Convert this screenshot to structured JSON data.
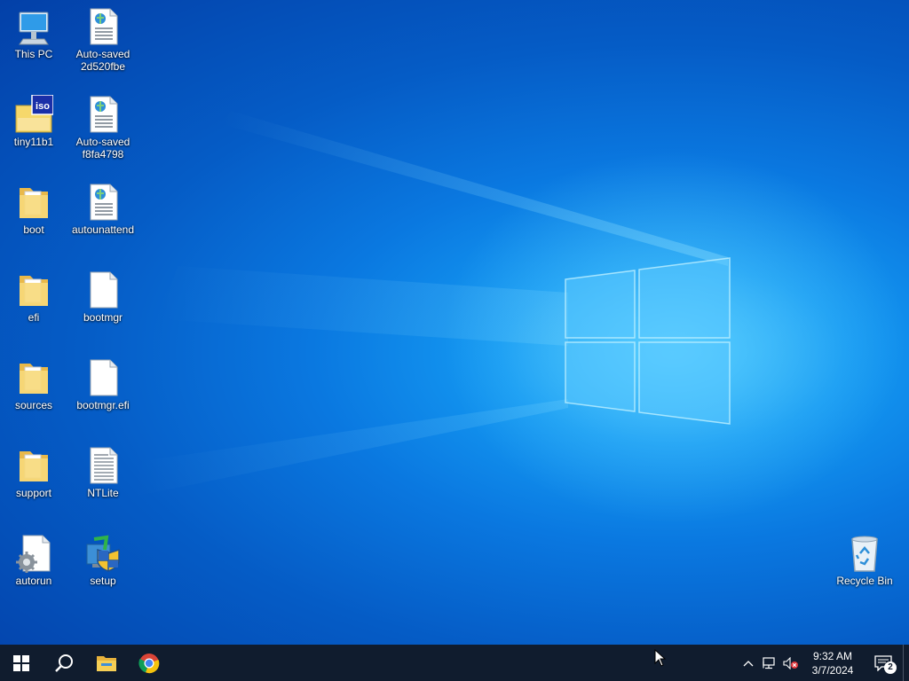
{
  "desktop": {
    "icons": [
      {
        "label": "This PC",
        "icon": "computer-icon"
      },
      {
        "label": "Auto-saved\n2d520fbe",
        "icon": "html-document-icon"
      },
      {
        "label": "tiny11b1",
        "icon": "iso-file-icon"
      },
      {
        "label": "Auto-saved\nf8fa4798",
        "icon": "html-document-icon"
      },
      {
        "label": "boot",
        "icon": "folder-icon"
      },
      {
        "label": "autounattend",
        "icon": "html-document-icon"
      },
      {
        "label": "efi",
        "icon": "folder-icon"
      },
      {
        "label": "bootmgr",
        "icon": "file-icon"
      },
      {
        "label": "sources",
        "icon": "folder-icon"
      },
      {
        "label": "bootmgr.efi",
        "icon": "file-icon"
      },
      {
        "label": "support",
        "icon": "folder-icon"
      },
      {
        "label": "NTLite",
        "icon": "text-document-icon"
      },
      {
        "label": "autorun",
        "icon": "settings-file-icon"
      },
      {
        "label": "setup",
        "icon": "setup-shield-icon"
      },
      {
        "label": "Recycle Bin",
        "icon": "recycle-bin-icon"
      }
    ]
  },
  "taskbar": {
    "pinned": [
      "start-icon",
      "search-icon",
      "file-explorer-icon",
      "chrome-icon"
    ],
    "clock": {
      "time": "9:32 AM",
      "date": "3/7/2024"
    },
    "notification_count": "2"
  },
  "colors": {
    "taskbar": "#101c2e",
    "wallpaper_accent": "#1499f2"
  }
}
